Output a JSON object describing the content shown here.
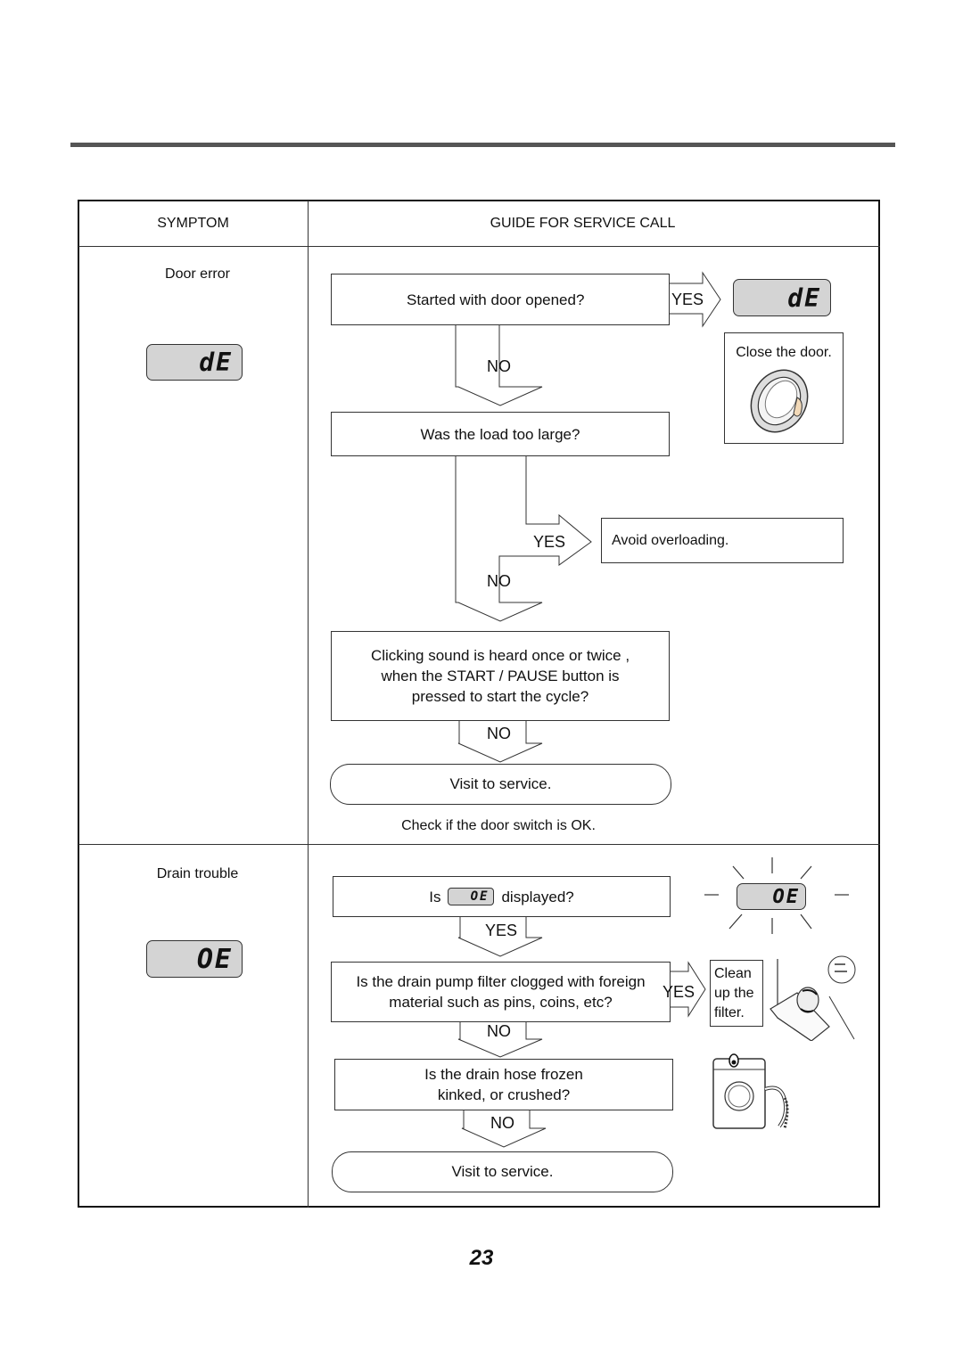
{
  "table": {
    "headers": {
      "symptom": "SYMPTOM",
      "guide": "GUIDE FOR SERVICE CALL"
    }
  },
  "door_error": {
    "symptom": "Door error",
    "display_code": "dE",
    "q1": "Started with door opened?",
    "q1_yes": "YES",
    "q1_no": "NO",
    "q1_yes_display": "dE",
    "q1_yes_action": "Close the door.",
    "q2": "Was the load too large?",
    "q2_yes": "YES",
    "q2_no": "NO",
    "q2_yes_action": "Avoid overloading.",
    "q3_lines": [
      "Clicking sound is heard once or twice ,",
      "when the START / PAUSE button is",
      "pressed to start the cycle?"
    ],
    "q3_no": "NO",
    "result": "Visit  to service.",
    "note": "Check if the door switch is OK."
  },
  "drain_trouble": {
    "symptom": "Drain trouble",
    "display_code": "OE",
    "q1_prefix": "Is",
    "q1_code": "OE",
    "q1_suffix": "displayed?",
    "q1_yes": "YES",
    "q1_flash_display": "OE",
    "q2_lines": [
      "Is the drain pump filter clogged with foreign",
      "material such as pins, coins, etc?"
    ],
    "q2_yes": "YES",
    "q2_no": "NO",
    "q2_yes_action_lines": [
      "Clean",
      "up the",
      "filter."
    ],
    "q3_lines": [
      "Is the drain hose frozen",
      "kinked, or crushed?"
    ],
    "q3_no": "NO",
    "result": "Visit  to service."
  },
  "page_number": "23"
}
